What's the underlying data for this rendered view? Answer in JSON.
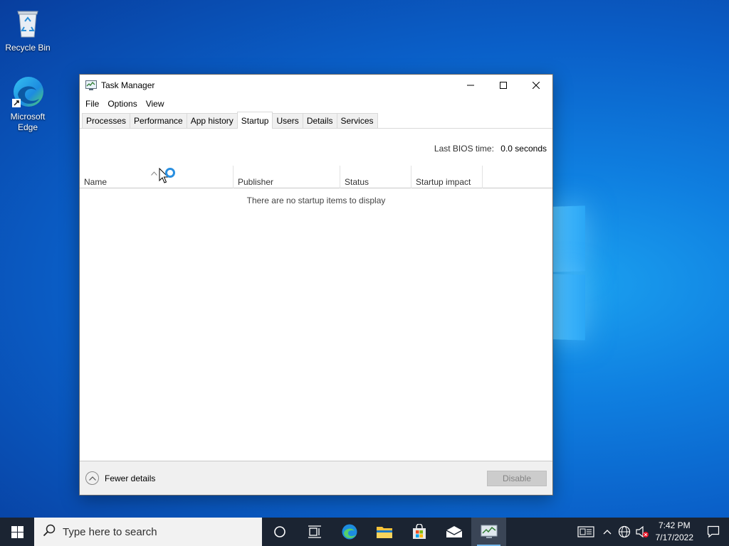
{
  "desktop": {
    "icons": [
      {
        "label": "Recycle Bin"
      },
      {
        "label": "Microsoft Edge"
      }
    ]
  },
  "window": {
    "title": "Task Manager",
    "menu": [
      "File",
      "Options",
      "View"
    ],
    "tabs": [
      "Processes",
      "Performance",
      "App history",
      "Startup",
      "Users",
      "Details",
      "Services"
    ],
    "active_tab": "Startup",
    "bios_label": "Last BIOS time:",
    "bios_value": "0.0 seconds",
    "columns": [
      "Name",
      "Publisher",
      "Status",
      "Startup impact"
    ],
    "empty_message": "There are no startup items to display",
    "fewer_details": "Fewer details",
    "disable_button": "Disable"
  },
  "taskbar": {
    "search_placeholder": "Type here to search",
    "time": "7:42 PM",
    "date": "7/17/2022"
  },
  "colors": {
    "taskbar": "#1b2432",
    "accent": "#0078d7"
  }
}
